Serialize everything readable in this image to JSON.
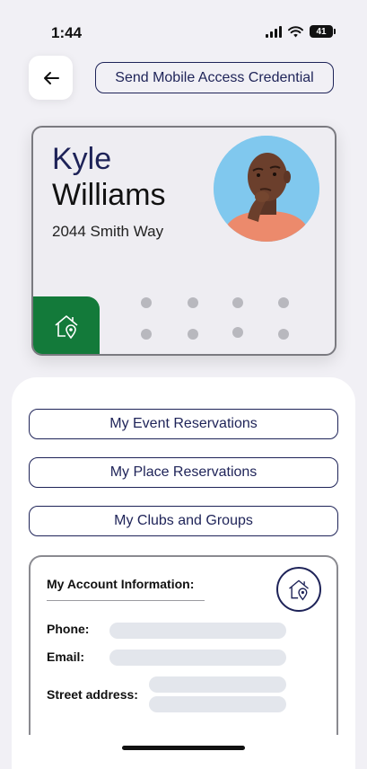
{
  "status_bar": {
    "time": "1:44",
    "battery": "41"
  },
  "header": {
    "back_icon": "arrow-left-icon",
    "send_button_label": "Send Mobile Access Credential"
  },
  "card": {
    "first_name": "Kyle",
    "last_name": "Williams",
    "address": "2044 Smith Way",
    "home_icon": "home-location-icon",
    "tile_color": "#137a3a"
  },
  "menu": {
    "event_reservations": "My Event Reservations",
    "place_reservations": "My Place Reservations",
    "clubs_groups": "My Clubs and Groups"
  },
  "account": {
    "title": "My Account Information:",
    "phone_label": "Phone:",
    "email_label": "Email:",
    "street_label": "Street address:",
    "icon": "home-location-icon"
  },
  "colors": {
    "accent_navy": "#1e2358",
    "background": "#f1f0f5"
  }
}
